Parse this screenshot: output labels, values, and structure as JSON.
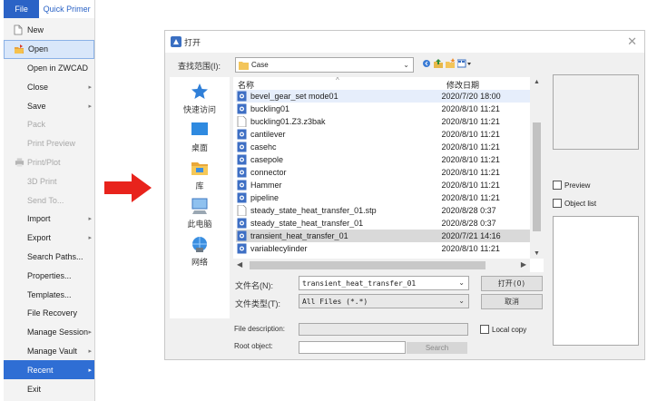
{
  "menu": {
    "tab_file": "File",
    "tab_primer": "Quick Primer",
    "items": [
      {
        "label": "New"
      },
      {
        "label": "Open"
      },
      {
        "label": "Open in ZWCAD"
      },
      {
        "label": "Close"
      },
      {
        "label": "Save"
      },
      {
        "label": "Pack"
      },
      {
        "label": "Print Preview"
      },
      {
        "label": "Print/Plot"
      },
      {
        "label": "3D Print"
      },
      {
        "label": "Send To..."
      },
      {
        "label": "Import"
      },
      {
        "label": "Export"
      },
      {
        "label": "Search Paths..."
      },
      {
        "label": "Properties..."
      },
      {
        "label": "Templates..."
      },
      {
        "label": "File Recovery"
      },
      {
        "label": "Manage Session"
      },
      {
        "label": "Manage Vault"
      },
      {
        "label": "Recent"
      },
      {
        "label": "Exit"
      }
    ]
  },
  "dialog": {
    "title": "打开",
    "lookin_label": "查找范围(I):",
    "lookin_value": "Case",
    "places": [
      {
        "label": "快速访问"
      },
      {
        "label": "桌面"
      },
      {
        "label": "库"
      },
      {
        "label": "此电脑"
      },
      {
        "label": "网络"
      }
    ],
    "columns": {
      "name": "名称",
      "date": "修改日期"
    },
    "files": [
      {
        "name": "bevel_gear_set mode01",
        "date": "2020/7/20 18:00"
      },
      {
        "name": "buckling01",
        "date": "2020/8/10 11:21"
      },
      {
        "name": "buckling01.Z3.z3bak",
        "date": "2020/8/10 11:21"
      },
      {
        "name": "cantilever",
        "date": "2020/8/10 11:21"
      },
      {
        "name": "casehc",
        "date": "2020/8/10 11:21"
      },
      {
        "name": "casepole",
        "date": "2020/8/10 11:21"
      },
      {
        "name": "connector",
        "date": "2020/8/10 11:21"
      },
      {
        "name": "Hammer",
        "date": "2020/8/10 11:21"
      },
      {
        "name": "pipeline",
        "date": "2020/8/10 11:21"
      },
      {
        "name": "steady_state_heat_transfer_01.stp",
        "date": "2020/8/28 0:37"
      },
      {
        "name": "steady_state_heat_transfer_01",
        "date": "2020/8/28 0:37"
      },
      {
        "name": "transient_heat_transfer_01",
        "date": "2020/7/21 14:16"
      },
      {
        "name": "variablecylinder",
        "date": "2020/8/10 11:21"
      }
    ],
    "filename_label": "文件名(N):",
    "filename_value": "transient_heat_transfer_01",
    "filetype_label": "文件类型(T):",
    "filetype_value": "All Files (*.*)",
    "open_button": "打开(O)",
    "cancel_button": "取消",
    "preview_label": "Preview",
    "objectlist_label": "Object list",
    "file_description_label": "File description:",
    "local_copy_label": "Local copy",
    "root_object_label": "Root object:",
    "search_button": "Search"
  },
  "colors": {
    "accent": "#2b63c6",
    "arrow": "#e8231c"
  }
}
